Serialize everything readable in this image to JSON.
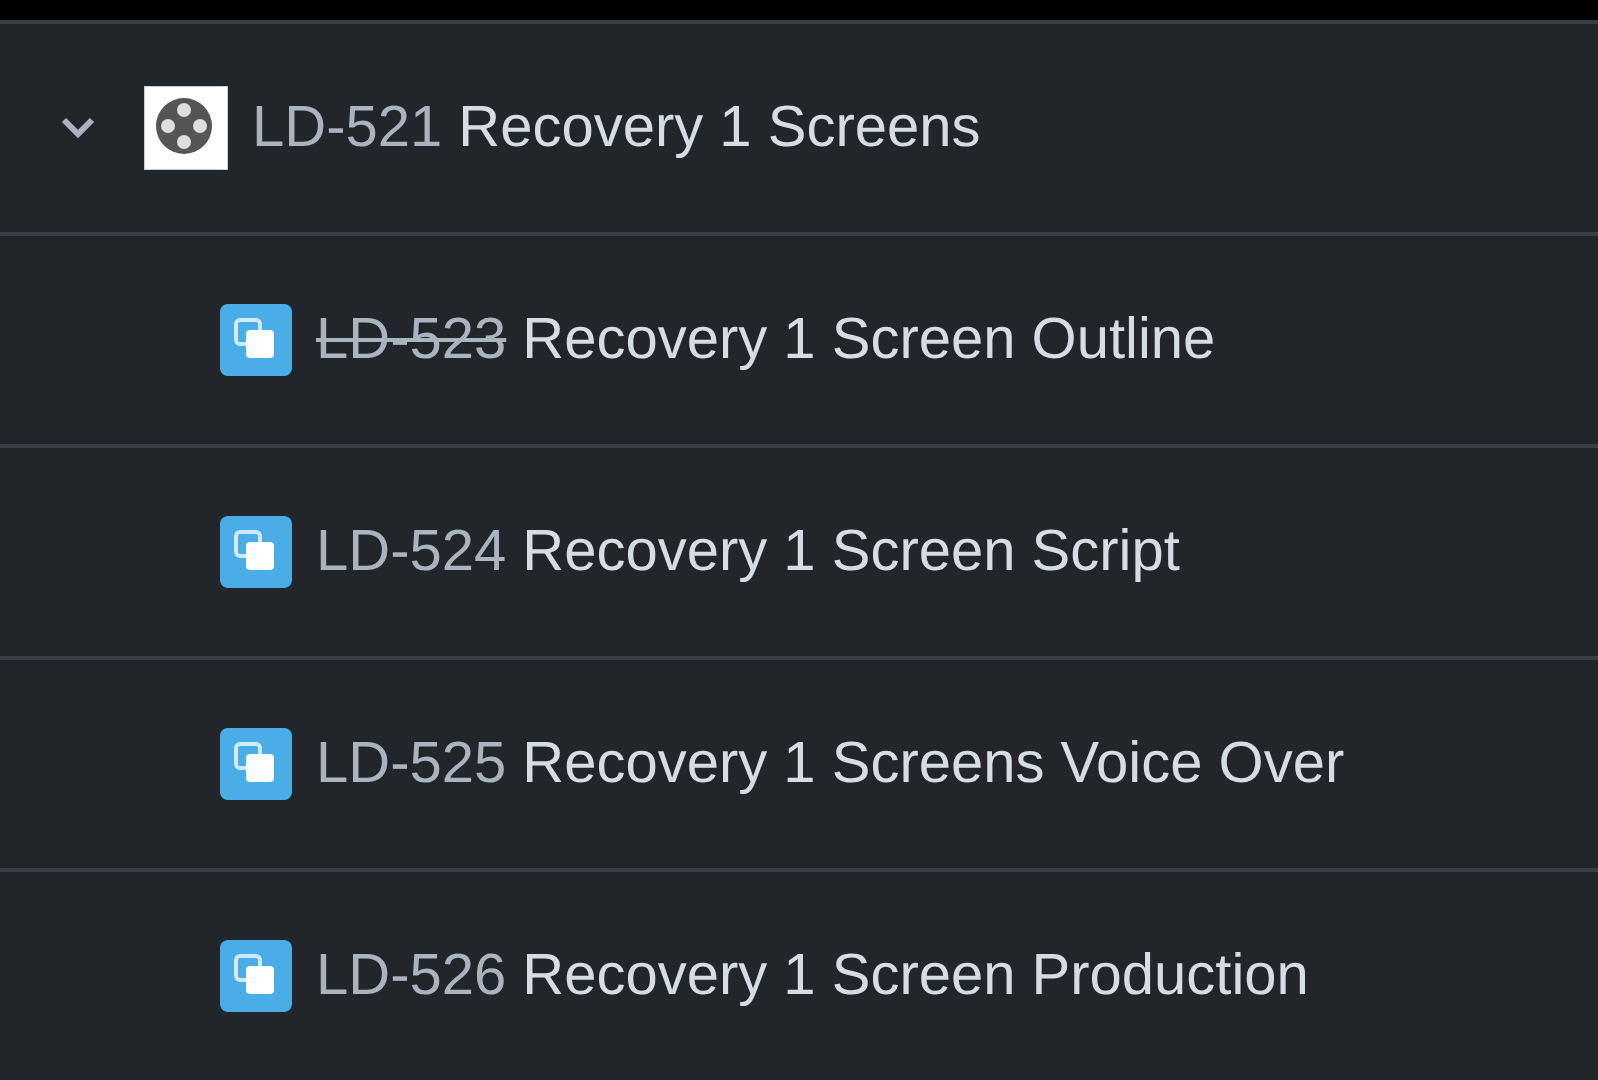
{
  "tree": [
    {
      "key": "LD-521",
      "summary": "Recovery 1 Screens",
      "expanded": true,
      "children": [
        {
          "key": "LD-523",
          "summary": "Recovery 1 Screen Outline",
          "done": true
        },
        {
          "key": "LD-524",
          "summary": "Recovery 1 Screen Script",
          "done": false
        },
        {
          "key": "LD-525",
          "summary": "Recovery 1 Screens Voice Over",
          "done": false
        },
        {
          "key": "LD-526",
          "summary": "Recovery 1 Screen Production",
          "done": false
        }
      ]
    }
  ]
}
